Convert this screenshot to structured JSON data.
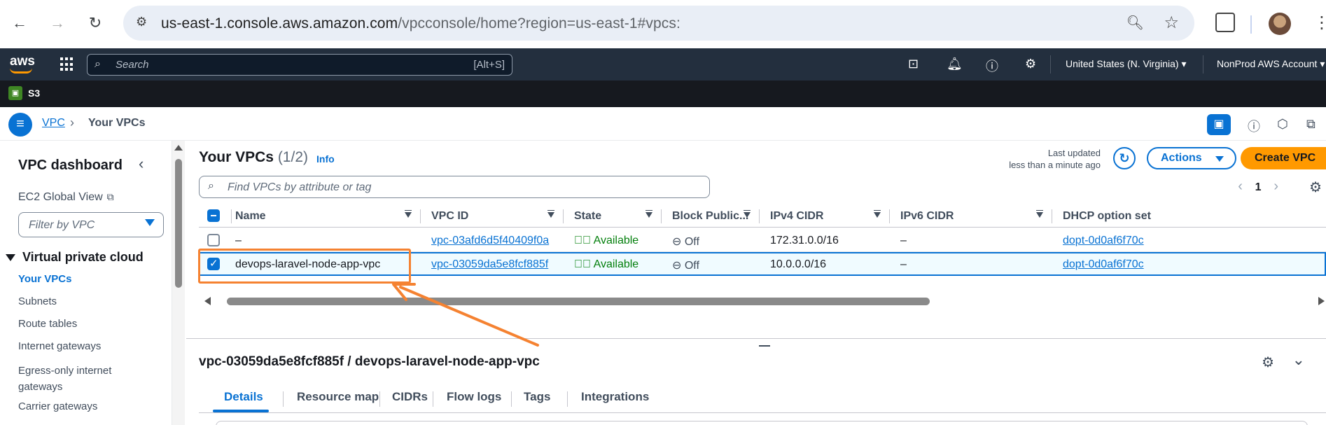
{
  "browser": {
    "url_host": "us-east-1.console.aws.amazon.com",
    "url_path": "/vpcconsole/home?region=us-east-1#vpcs:"
  },
  "aws_nav": {
    "logo": "aws",
    "search_placeholder": "Search",
    "search_shortcut": "[Alt+S]",
    "region": "United States (N. Virginia)",
    "account": "NonProd AWS Account",
    "favorite": "S3"
  },
  "breadcrumb": {
    "root": "VPC",
    "current": "Your VPCs"
  },
  "sidebar": {
    "title": "VPC dashboard",
    "ec2_global": "EC2 Global View",
    "filter_placeholder": "Filter by VPC",
    "section": "Virtual private cloud",
    "items": [
      {
        "label": "Your VPCs",
        "active": true
      },
      {
        "label": "Subnets"
      },
      {
        "label": "Route tables"
      },
      {
        "label": "Internet gateways"
      },
      {
        "label": "Egress-only internet gateways"
      },
      {
        "label": "Carrier gateways"
      }
    ]
  },
  "table": {
    "title": "Your VPCs",
    "count": "(1/2)",
    "info": "Info",
    "last_updated_label": "Last updated",
    "last_updated_value": "less than a minute ago",
    "actions_label": "Actions",
    "create_label": "Create VPC",
    "search_placeholder": "Find VPCs by attribute or tag",
    "page": "1",
    "columns": [
      "Name",
      "VPC ID",
      "State",
      "Block Public...",
      "IPv4 CIDR",
      "IPv6 CIDR",
      "DHCP option set"
    ],
    "rows": [
      {
        "selected": false,
        "name": "–",
        "vpc_id": "vpc-03afd6d5f40409f0a",
        "state": "Available",
        "block_public": "Off",
        "ipv4": "172.31.0.0/16",
        "ipv6": "–",
        "dhcp": "dopt-0d0af6f70c"
      },
      {
        "selected": true,
        "name": "devops-laravel-node-app-vpc",
        "vpc_id": "vpc-03059da5e8fcf885f",
        "state": "Available",
        "block_public": "Off",
        "ipv4": "10.0.0.0/16",
        "ipv6": "–",
        "dhcp": "dopt-0d0af6f70c"
      }
    ]
  },
  "detail": {
    "title": "vpc-03059da5e8fcf885f / devops-laravel-node-app-vpc",
    "tabs": [
      "Details",
      "Resource map",
      "CIDRs",
      "Flow logs",
      "Tags",
      "Integrations"
    ]
  },
  "colors": {
    "aws_dark": "#232f3e",
    "link_blue": "#0972d3",
    "available_green": "#037f0c",
    "create_orange": "#ff9900",
    "annotation_orange": "#f58231"
  }
}
